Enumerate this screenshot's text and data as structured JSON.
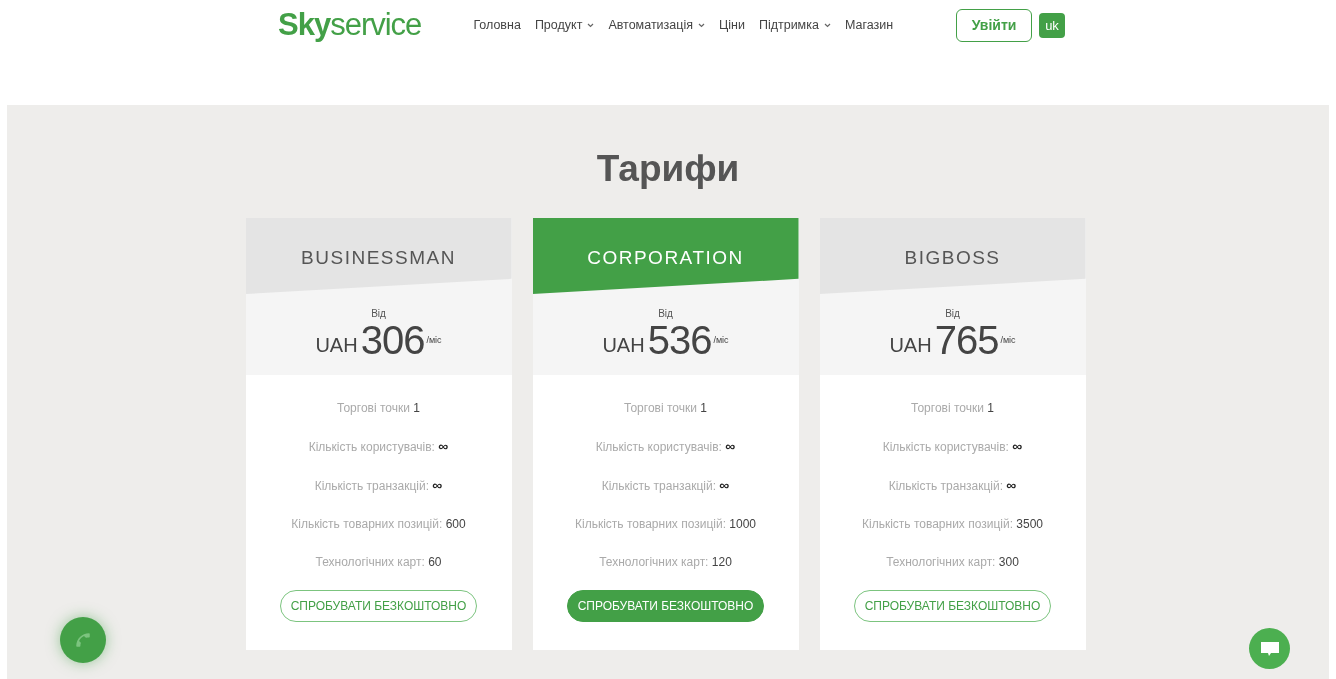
{
  "header": {
    "logo": {
      "bold": "Sky",
      "light": "service"
    },
    "nav": [
      {
        "label": "Головна",
        "dropdown": false
      },
      {
        "label": "Продукт",
        "dropdown": true
      },
      {
        "label": "Автоматизація",
        "dropdown": true
      },
      {
        "label": "Ціни",
        "dropdown": false
      },
      {
        "label": "Підтримка",
        "dropdown": true
      },
      {
        "label": "Магазин",
        "dropdown": false
      }
    ],
    "login": "Увійти",
    "language": "uk"
  },
  "pricing": {
    "title": "Тарифи",
    "plans": [
      {
        "name": "BUSINESSMAN",
        "featured": false,
        "from": "Від",
        "currency": "UAH",
        "price": "306",
        "period": "/міс",
        "features": [
          {
            "label": "Торгові точки",
            "value": "1"
          },
          {
            "label": "Кількість користувачів:",
            "value": "∞"
          },
          {
            "label": "Кількість транзакцій:",
            "value": "∞"
          },
          {
            "label": "Кількість товарних позицій:",
            "value": "600"
          },
          {
            "label": "Технологічних карт:",
            "value": "60"
          }
        ],
        "button": "СПРОБУВАТИ БЕЗКОШТОВНО"
      },
      {
        "name": "CORPORATION",
        "featured": true,
        "from": "Від",
        "currency": "UAH",
        "price": "536",
        "period": "/міс",
        "features": [
          {
            "label": "Торгові точки",
            "value": "1"
          },
          {
            "label": "Кількість користувачів:",
            "value": "∞"
          },
          {
            "label": "Кількість транзакцій:",
            "value": "∞"
          },
          {
            "label": "Кількість товарних позицій:",
            "value": "1000"
          },
          {
            "label": "Технологічних карт:",
            "value": "120"
          }
        ],
        "button": "СПРОБУВАТИ БЕЗКОШТОВНО"
      },
      {
        "name": "BIGBOSS",
        "featured": false,
        "from": "Від",
        "currency": "UAH",
        "price": "765",
        "period": "/міс",
        "features": [
          {
            "label": "Торгові точки",
            "value": "1"
          },
          {
            "label": "Кількість користувачів:",
            "value": "∞"
          },
          {
            "label": "Кількість транзакцій:",
            "value": "∞"
          },
          {
            "label": "Кількість товарних позицій:",
            "value": "3500"
          },
          {
            "label": "Технологічних карт:",
            "value": "300"
          }
        ],
        "button": "СПРОБУВАТИ БЕЗКОШТОВНО"
      }
    ]
  }
}
